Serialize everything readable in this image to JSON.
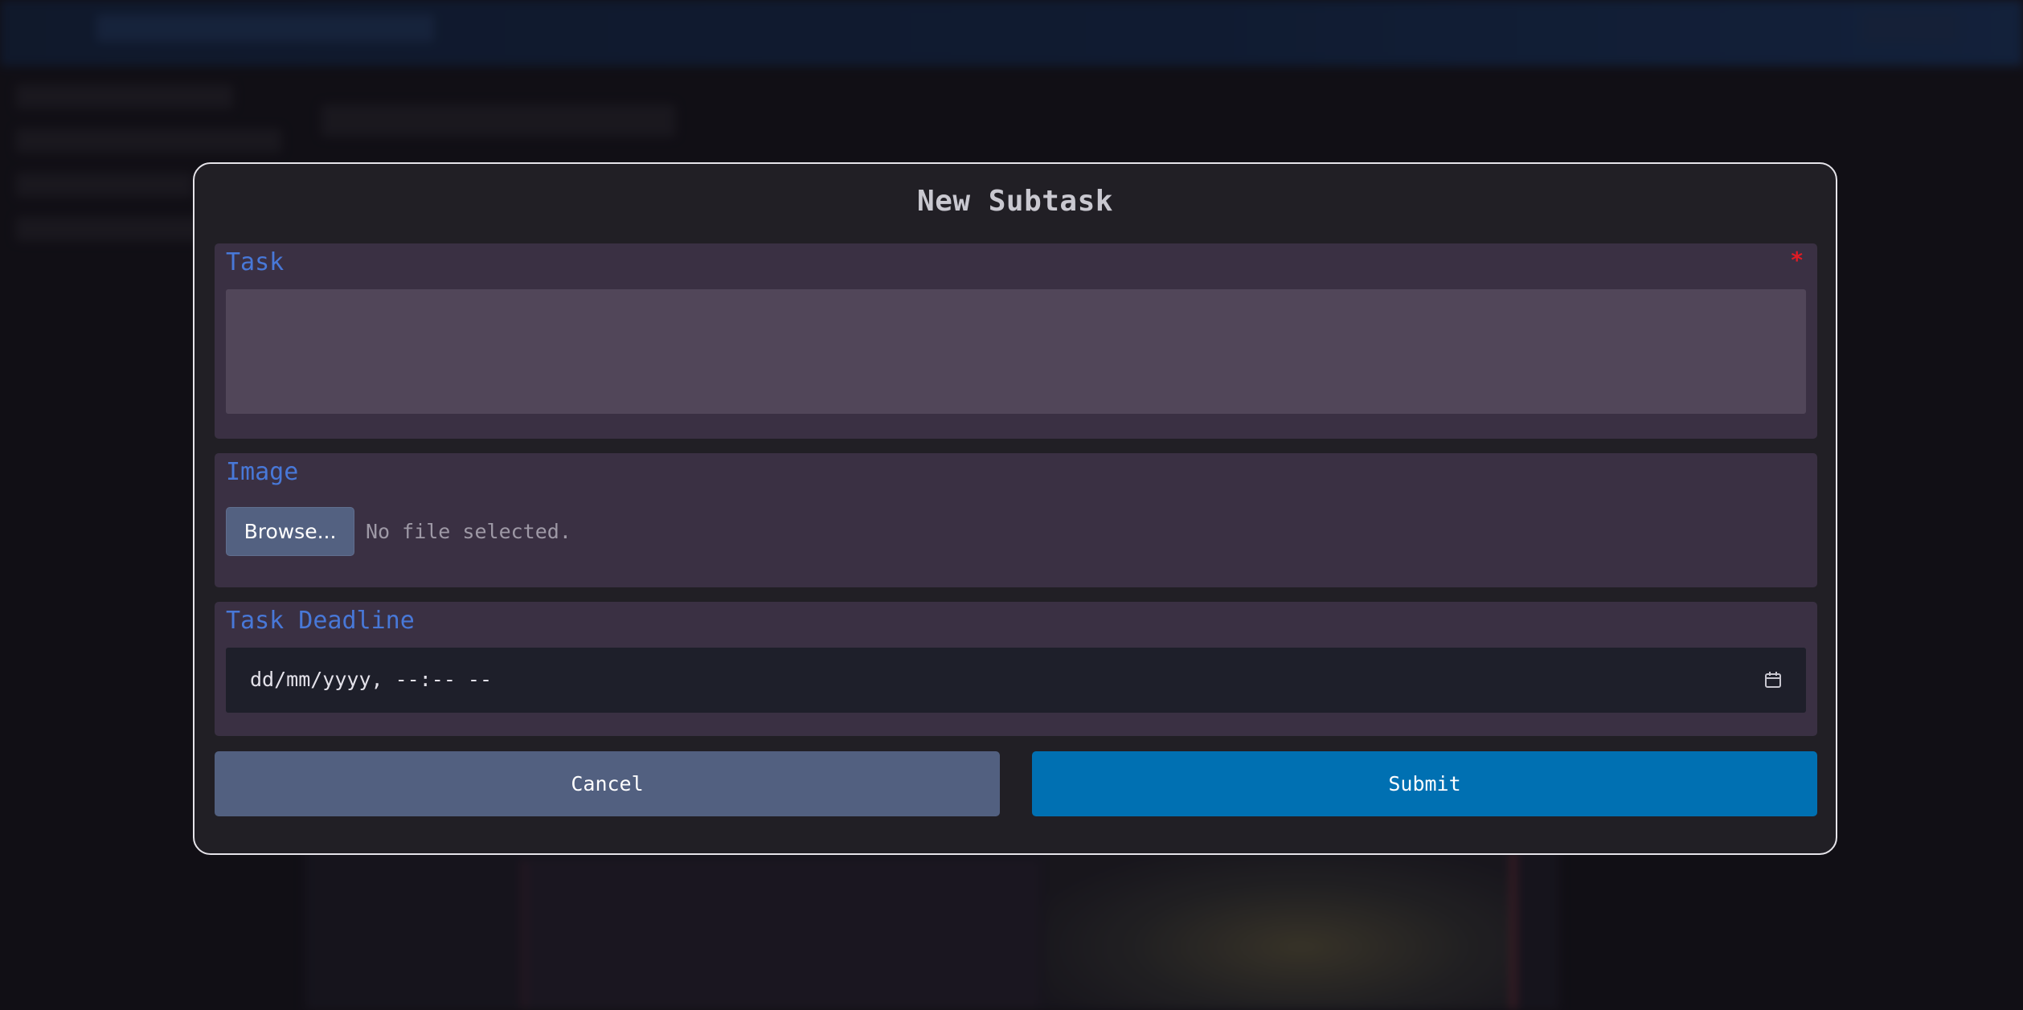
{
  "modal": {
    "title": "New Subtask",
    "task_field": {
      "label": "Task",
      "required_mark": "*",
      "value": ""
    },
    "image_field": {
      "label": "Image",
      "browse_label": "Browse...",
      "file_status": "No file selected."
    },
    "deadline_field": {
      "label": "Task Deadline",
      "value_placeholder": "dd/mm/yyyy, --:-- --",
      "icon": "calendar-icon"
    },
    "buttons": {
      "cancel_label": "Cancel",
      "submit_label": "Submit"
    }
  },
  "colors": {
    "accent_label": "#4878d8",
    "required": "#e01b24",
    "submit": "#0070b2",
    "cancel": "#526080",
    "panel": "#3a3043",
    "modal_bg": "#211f25"
  }
}
